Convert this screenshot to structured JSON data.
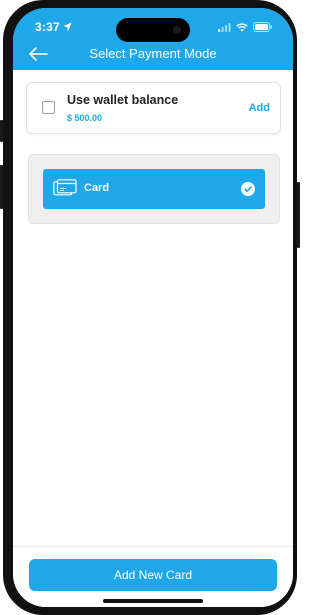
{
  "status_bar": {
    "time": "3:37"
  },
  "header": {
    "title": "Select Payment Mode",
    "back_icon": "arrow-left-icon"
  },
  "wallet": {
    "label": "Use wallet balance",
    "amount": "$ 500.00",
    "add_label": "Add",
    "checked": false
  },
  "payment_options": [
    {
      "label": "Card",
      "icon": "credit-card-icon",
      "selected": true
    }
  ],
  "footer": {
    "button_label": "Add New Card"
  },
  "colors": {
    "accent": "#1ea7e9",
    "background": "#ffffff",
    "panel": "#efefef"
  }
}
